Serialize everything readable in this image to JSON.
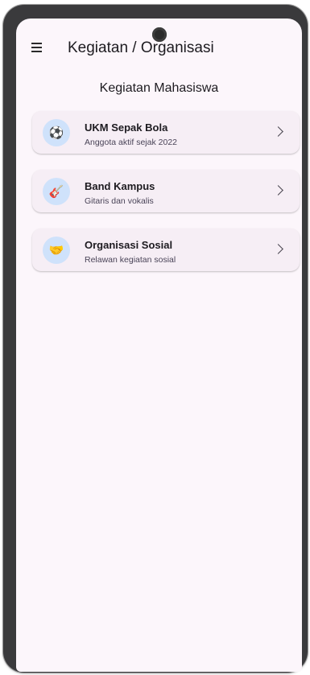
{
  "app_bar": {
    "title": "Kegiatan / Organisasi",
    "menu_icon": "hamburger-menu-icon"
  },
  "page": {
    "section_title": "Kegiatan Mahasiswa"
  },
  "colors": {
    "background": "#fcf6fb",
    "card": "#f6eef5",
    "avatar": "#cfe2fb",
    "text": "#1d1b20"
  },
  "activities": [
    {
      "title": "UKM Sepak Bola",
      "subtitle": "Anggota aktif sejak 2022",
      "icon": "soccer-ball-icon",
      "emoji": "⚽"
    },
    {
      "title": "Band Kampus",
      "subtitle": "Gitaris dan vokalis",
      "icon": "guitar-icon",
      "emoji": "🎸"
    },
    {
      "title": "Organisasi Sosial",
      "subtitle": "Relawan kegiatan sosial",
      "icon": "handshake-icon",
      "emoji": "🤝"
    }
  ]
}
